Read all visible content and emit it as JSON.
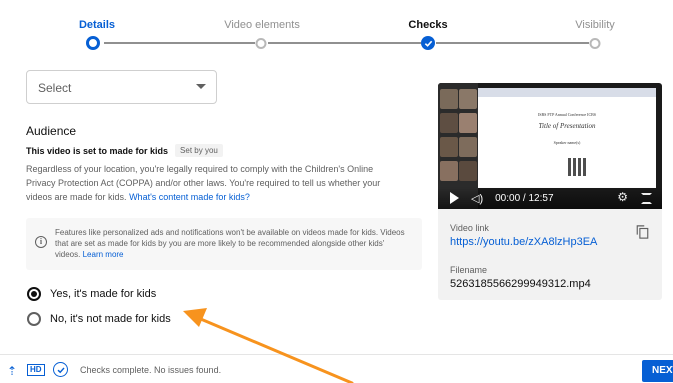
{
  "stepper": {
    "steps": [
      {
        "label": "Details",
        "state": "active"
      },
      {
        "label": "Video elements",
        "state": "todo"
      },
      {
        "label": "Checks",
        "state": "done"
      },
      {
        "label": "Visibility",
        "state": "todo"
      }
    ]
  },
  "form": {
    "select_value": "Select",
    "audience_title": "Audience",
    "kids_status": "This video is set to made for kids",
    "set_by_badge": "Set by you",
    "description": "Regardless of your location, you're legally required to comply with the Children's Online Privacy Protection Act (COPPA) and/or other laws. You're required to tell us whether your videos are made for kids.",
    "description_link": "What's content made for kids?",
    "info_text": "Features like personalized ads and notifications won't be available on videos made for kids. Videos that are set as made for kids by you are more likely to be recommended alongside other kids' videos.",
    "info_link": "Learn more",
    "radio_yes": "Yes, it's made for kids",
    "radio_no": "No, it's not made for kids",
    "selected": "yes"
  },
  "video": {
    "time_display": "00:00 / 12:57",
    "link_label": "Video link",
    "link": "https://youtu.be/zXA8lzHp3EA",
    "filename_label": "Filename",
    "filename": "5263185566299949312.mp4",
    "slide_header": "ISBS FTP Annual Conference ICBS",
    "slide_title": "Title of Presentation",
    "slide_presenter": "Speaker name(s)"
  },
  "bottom_bar": {
    "status": "Checks complete. No issues found.",
    "next_label": "NEXT"
  },
  "colors": {
    "accent": "#065fd4",
    "annotation_arrow": "#f7931e"
  },
  "icons": [
    "upload-icon",
    "hd-icon",
    "check-circle-icon",
    "info-icon",
    "copy-icon",
    "play-icon",
    "volume-icon",
    "settings-icon",
    "fullscreen-icon",
    "chevron-down-icon"
  ]
}
